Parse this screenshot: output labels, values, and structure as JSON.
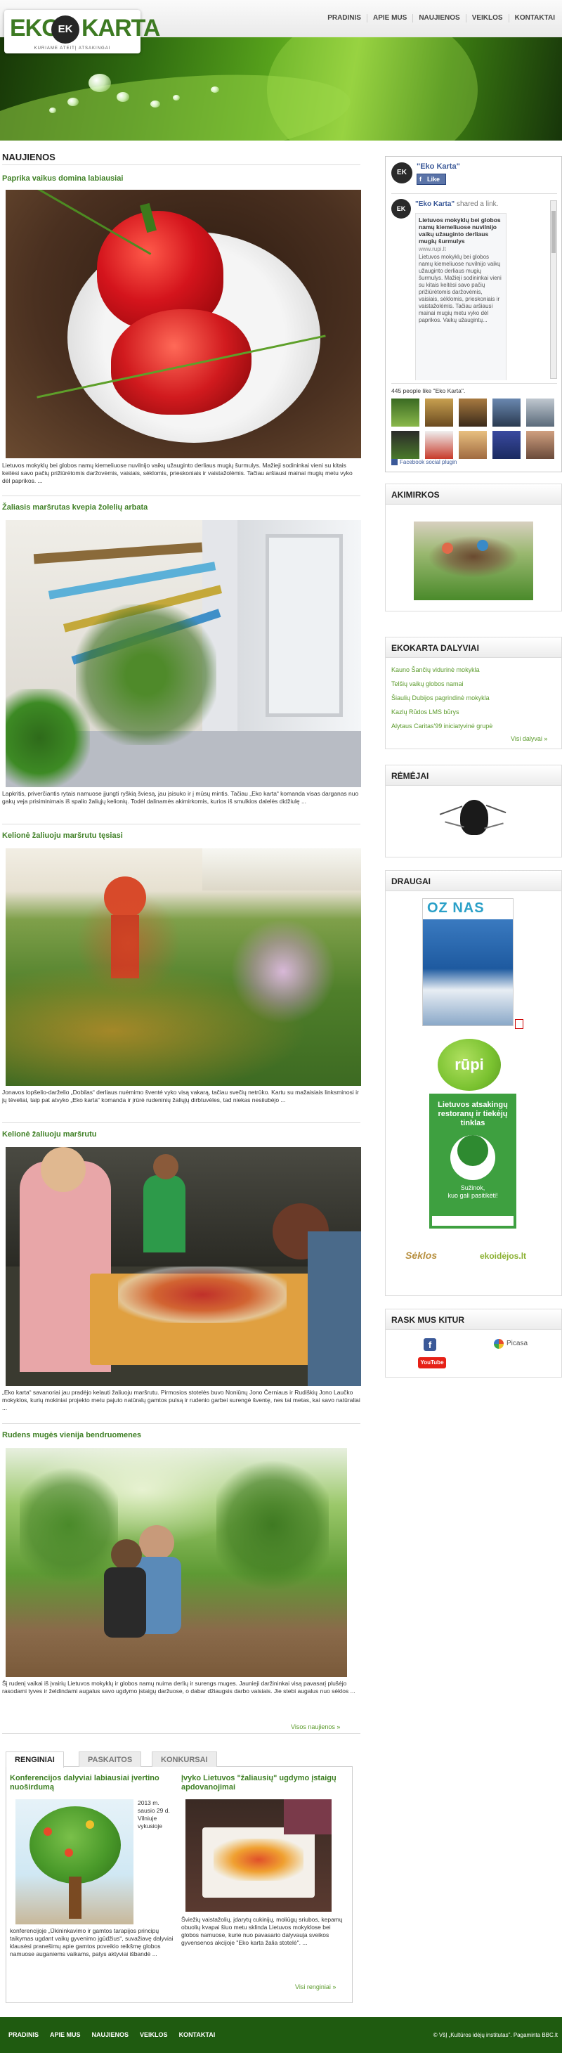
{
  "header": {
    "logo_left": "EKO",
    "logo_mark": "EK",
    "logo_right": "KARTA",
    "logo_tagline": "Kuriame ateitį atsakingai",
    "nav": [
      "PRADINIS",
      "APIE MUS",
      "NAUJIENOS",
      "VEIKLOS",
      "KONTAKTAI"
    ]
  },
  "news": {
    "section_title": "NAUJIENOS",
    "articles": [
      {
        "title": "Paprika vaikus domina labiausiai",
        "text": "Lietuvos mokyklų bei globos namų kiemeliuose nuvilnijo vaikų užauginto derliaus mugių šurmulys. Mažieji sodininkai vieni su kitais keitėsi savo pačių prižiūrėtomis daržovėmis, vaisiais, sėklomis, prieskoniais ir vaistažolėmis. Tačiau aršiausi mainai mugių metu vyko dėl paprikos. ..."
      },
      {
        "title": "Žaliasis maršrutas kvepia žolelių arbata",
        "text": "Lapkritis, priverčiantis rytais namuose įjungti ryškią šviesą, jau įsisuko ir į mūsų mintis. Tačiau „Eko karta“ komanda visas darganas nuo gakų veja prisiminimais iš spalio žaliųjų kelionių. Todėl dalinamės akimirkomis, kurios iš smulkios dalelės didžiulę ..."
      },
      {
        "title": "Kelionė žaliuoju maršrutu tęsiasi",
        "text": "Jonavos lopšelio-darželio „Dobilas“ derliaus nuėmimo šventė vyko visą vakarą, tačiau svečių netrūko. Kartu su mažaisiais linksminosi ir jų tėveliai, taip pat atvyko „Eko karta“ komanda ir įrūrė rudeninių žaliųjų dirbtuvėles, tad niekas nesiiubėjo ..."
      },
      {
        "title": "Kelionė žaliuoju maršrutu",
        "text": "„Eko karta“ savanoriai jau pradėjo kelauti žaliuoju maršrutu. Pirmosios stotelės buvo Noniūnų Jono Černiaus ir Rudiškių Jono Laučko mokyklos, kurių mokiniai projekto metu pajuto natūralų gamtos pulsą ir rudenio garbei surengė šventę, nes tai metas, kai savo natūraliai ..."
      },
      {
        "title": "Rudens mugės vienija bendruomenes",
        "text": "Šį rudenį vaikai iš įvairių Lietuvos mokyklų ir globos namų nuima derlių ir surengs muges. Jaunieji daržininkai visą pavasarį plušėjo rasodami tyves ir želdindami augalus savo ugdymo įstaigų daržuose, o dabar džiaugsis darbo vaisiais. Jie stebi augalus nuo sėklos ..."
      }
    ],
    "all_link": "Visos naujienos »"
  },
  "tabs": {
    "items": [
      "RENGINIAI",
      "PASKAITOS",
      "KONKURSAI"
    ],
    "active": "RENGINIAI",
    "left": {
      "title": "Konferencijos dalyviai labiausiai įvertino nuoširdumą",
      "date_text": "2013 m. sausio 29 d. Vilniuje vykusioje",
      "text": "konferencijoje „Ūkininkavimo ir gamtos tarapijos principų taikymas ugdant vaikų gyvenimo įgūdžius“, suvažiavę dalyviai klausėsi pranešimų apie gamtos poveikio reikšmę globos namuose auganiems vaikams, patys aktyviai išbandė ..."
    },
    "right": {
      "title": "Įvyko Lietuvos \"žaliausių\" ugdymo įstaigų apdovanojimai",
      "text": "Šviežių vaistažolių, įdarytų cukinijų, moliūgų sriubos, kepamų obuolių kvapai šiuo metu sklinda Lietuvos mokyklose bei globos namuose, kurie nuo pavasario dalyvauja sveikos gyvensenos akcijoje \"Eko karta žalia stotelė\". ..."
    },
    "all_link": "Visi renginiai »"
  },
  "facebook": {
    "page_name": "\"Eko Karta\"",
    "like_label": "Like",
    "post_author": "\"Eko Karta\"",
    "post_action": "shared a link.",
    "link_title": "Lietuvos mokyklų bei globos namų kiemeliuose nuvilnijo vaikų užauginto derliaus mugių šurmulys",
    "link_domain": "www.rupi.lt",
    "link_text": "Lietuvos mokyklų bei globos namų kiemeliuose nuvilnijo vaikų užauginto derliaus mugių šurmulys. Mažieji sodininkai vieni su kitais keitėsi savo pačių prižiūrėtomis daržovėmis, vaisiais, sėklomis, prieskoniais ir vaistažolėmis. Tačiau aršiausi mainai mugių metu vyko dėl paprikos. Vaikų užaugintų...",
    "likes_text": "445 people like \"Eko Karta\".",
    "plugin_label": "Facebook social plugin"
  },
  "sidebar": {
    "akimirkos_title": "AKIMIRKOS",
    "partners_title": "EKOKARTA DALYVIAI",
    "partners": [
      "Kauno Šančių vidurinė mokykla",
      "Telšių vaikų globos namai",
      "Šiaulių Dubijos pagrindinė mokykla",
      "Kazlų Rūdos LMS būrys",
      "Alytaus Caritas'99 iniciatyvinė grupė"
    ],
    "partners_all": "Visi dalyvai »",
    "sponsors_title": "RĖMĖJAI",
    "friends_title": "DRAUGAI",
    "magazine_name": "OZ NAS",
    "rupi_label": "rūpi",
    "ad_lines": [
      "Lietuvos atsakingų",
      "restoranų ir tiekėjų",
      "tinklas"
    ],
    "ad_sub": [
      "Sužinok,",
      "kuo gali pasitikėti!"
    ],
    "sekos_label": "Sėklos",
    "ekoidejos_label": "ekoidėjos.lt",
    "find_title": "RASK MUS KITUR",
    "picasa_label": "Picasa",
    "youtube_label": "YouTube"
  },
  "footer": {
    "nav": [
      "PRADINIS",
      "APIE MUS",
      "NAUJIENOS",
      "VEIKLOS",
      "KONTAKTAI"
    ],
    "copyright": "© VšĮ „Kultūros idėjų institutas\". Pagaminta BBC.lt"
  }
}
